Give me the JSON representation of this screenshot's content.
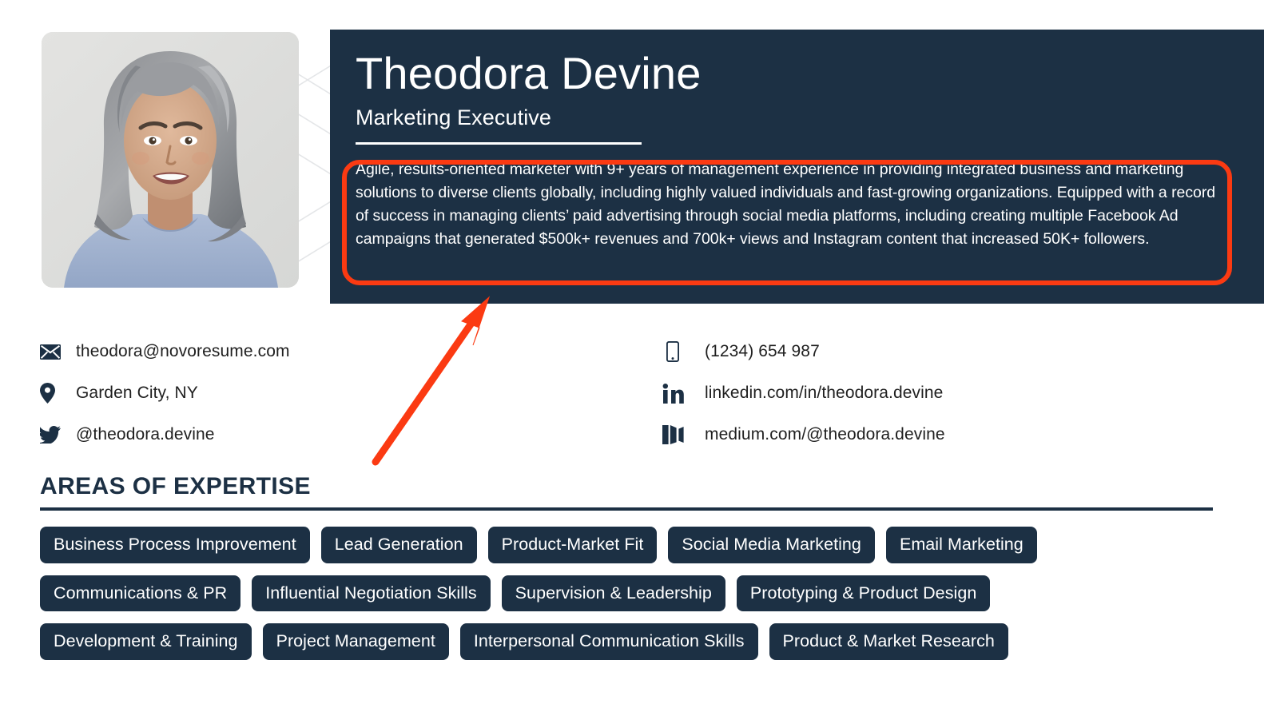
{
  "colors": {
    "navy": "#1c3044",
    "annotation_red": "#fb3a12",
    "text_dark": "#1f1f1f",
    "white": "#ffffff"
  },
  "header": {
    "name": "Theodora Devine",
    "job_title": "Marketing Executive",
    "summary": "Agile, results-oriented marketer with 9+ years of management experience in providing integrated business and marketing solutions to diverse clients globally, including highly valued individuals and fast-growing organizations. Equipped with a record of success in managing clients’ paid advertising through social media platforms, including creating multiple Facebook Ad campaigns that generated $500k+ revenues and 700k+ views and Instagram content that increased 50K+ followers.",
    "photo_alt": "Portrait photo of a smiling woman with gray shoulder-length hair wearing a light blue sweater"
  },
  "contacts": {
    "left": [
      {
        "icon": "envelope-icon",
        "text": "theodora@novoresume.com"
      },
      {
        "icon": "location-pin-icon",
        "text": "Garden City, NY"
      },
      {
        "icon": "twitter-icon",
        "text": "@theodora.devine"
      }
    ],
    "right": [
      {
        "icon": "mobile-phone-icon",
        "text": "(1234) 654 987"
      },
      {
        "icon": "linkedin-icon",
        "text": "linkedin.com/in/theodora.devine"
      },
      {
        "icon": "medium-icon",
        "text": "medium.com/@theodora.devine"
      }
    ]
  },
  "expertise": {
    "heading": "AREAS OF EXPERTISE",
    "rows": [
      [
        "Business Process Improvement",
        "Lead Generation",
        "Product-Market Fit",
        "Social Media Marketing",
        "Email Marketing"
      ],
      [
        "Communications & PR",
        "Influential Negotiation Skills",
        "Supervision & Leadership",
        "Prototyping & Product Design"
      ],
      [
        "Development & Training",
        "Project Management",
        "Interpersonal Communication Skills",
        "Product & Market Research"
      ]
    ]
  },
  "annotations": {
    "highlight_box_target": "summary",
    "arrow_points_to": "summary"
  }
}
